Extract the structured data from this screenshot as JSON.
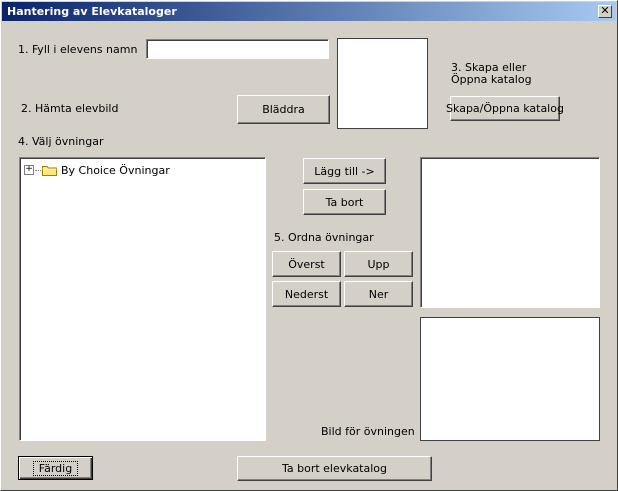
{
  "window": {
    "title": "Hantering av Elevkataloger",
    "close_glyph": "✕"
  },
  "step1": {
    "label": "1. Fyll i elevens namn",
    "value": "",
    "placeholder": ""
  },
  "step2": {
    "label": "2. Hämta elevbild",
    "browse_button": "Bläddra"
  },
  "step3": {
    "label_line1": "3. Skapa eller",
    "label_line2": "Öppna katalog",
    "button": "Skapa/Öppna katalog"
  },
  "step4": {
    "label": "4. Välj övningar",
    "tree": [
      {
        "label": "By Choice Övningar",
        "expander": "+",
        "icon": "folder-icon"
      }
    ]
  },
  "add_button": "Lägg till ->",
  "remove_button": "Ta bort",
  "step5": {
    "label": "5. Ordna övningar",
    "top_button": "Överst",
    "up_button": "Upp",
    "bottom_button": "Nederst",
    "down_button": "Ner"
  },
  "exercise_image_label": "Bild för övningen",
  "done_button": "Färdig",
  "delete_catalog_button": "Ta bort elevkatalog"
}
